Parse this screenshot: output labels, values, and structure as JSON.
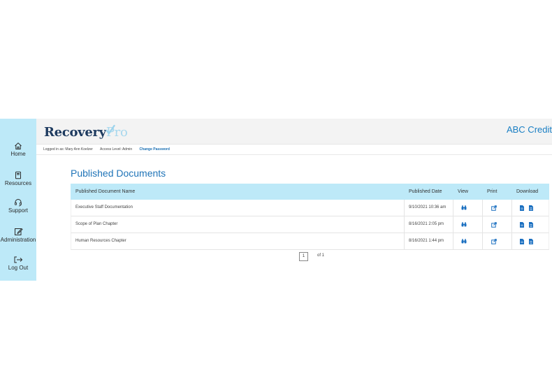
{
  "sidebar": {
    "items": [
      {
        "label": "Home",
        "icon": "home-icon"
      },
      {
        "label": "Resources",
        "icon": "book-icon"
      },
      {
        "label": "Support",
        "icon": "headset-icon"
      },
      {
        "label": "Administration",
        "icon": "edit-icon"
      },
      {
        "label": "Log Out",
        "icon": "logout-icon"
      }
    ]
  },
  "header": {
    "logo_main": "Recovery",
    "logo_accent": "Pro",
    "company": "ABC Credit"
  },
  "user": {
    "logged_in": "Logged in as: Mary Ann Koelzer",
    "access": "Access Level: Admin",
    "change_password": "Change Password"
  },
  "page": {
    "title": "Published Documents"
  },
  "table": {
    "columns": [
      "Published Document Name",
      "Published Date",
      "View",
      "Print",
      "Download"
    ],
    "rows": [
      {
        "name": "Executive Staff Documentation",
        "date": "9/10/2021 10:36 am"
      },
      {
        "name": "Scope of Plan Chapter",
        "date": "8/16/2021 2:05 pm"
      },
      {
        "name": "Human Resources Chapter",
        "date": "8/16/2021 1:44 pm"
      }
    ]
  },
  "pager": {
    "current": "1",
    "of": "of 1"
  },
  "colors": {
    "sidebar_bg": "#bde9f8",
    "header_bg": "#f3f3f3",
    "accent": "#1f74b8",
    "icon_blue": "#1a6fc0"
  }
}
